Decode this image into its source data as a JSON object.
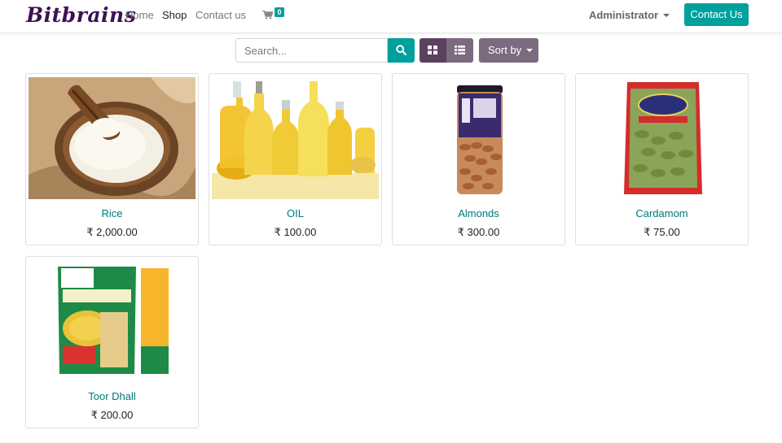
{
  "brand": {
    "logo_text": "Bitbrains"
  },
  "nav": {
    "items": [
      {
        "label": "Home"
      },
      {
        "label": "Shop"
      },
      {
        "label": "Contact us"
      }
    ],
    "cart_count": "0",
    "user_menu_label": "Administrator",
    "contact_button_label": "Contact Us"
  },
  "toolbar": {
    "search_placeholder": "Search...",
    "sort_label": "Sort by",
    "view_grid_icon": "grid-icon",
    "view_list_icon": "list-icon"
  },
  "products": [
    {
      "name": "Rice",
      "price": "₹ 2,000.00",
      "image": "rice-bowl-image"
    },
    {
      "name": "OIL",
      "price": "₹ 100.00",
      "image": "oil-bottles-image"
    },
    {
      "name": "Almonds",
      "price": "₹ 300.00",
      "image": "almond-jar-image"
    },
    {
      "name": "Cardamom",
      "price": "₹ 75.00",
      "image": "cardamom-pack-image"
    },
    {
      "name": "Toor Dhall",
      "price": "₹ 200.00",
      "image": "toor-dal-pack-image"
    }
  ],
  "colors": {
    "brand": "#3d1154",
    "accent": "#00a09d",
    "secondary": "#7c6a80",
    "product_link": "#00787a"
  }
}
